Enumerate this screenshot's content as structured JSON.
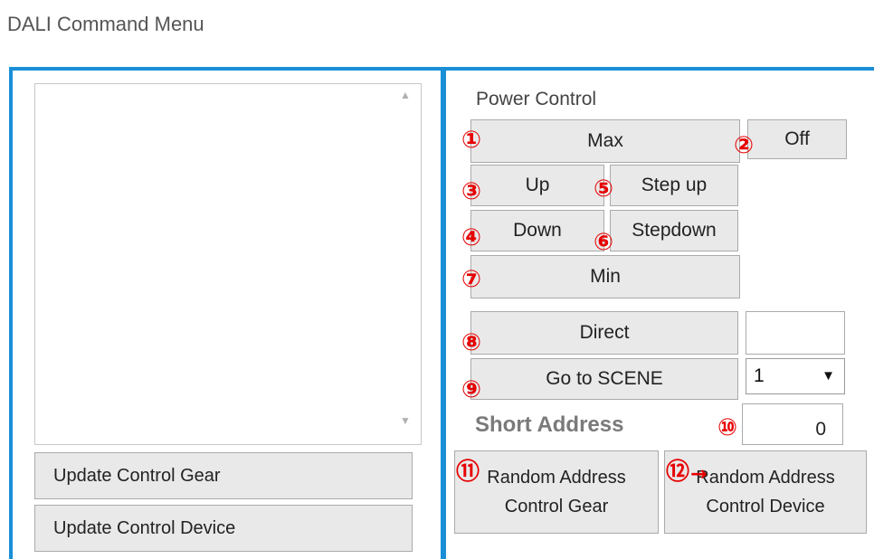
{
  "window": {
    "title": "DALI Command Menu"
  },
  "left_panel": {
    "buttons": {
      "update_gear": "Update  Control Gear",
      "update_device": "Update  Control Device"
    }
  },
  "power_control": {
    "title": "Power Control",
    "max": "Max",
    "off": "Off",
    "up": "Up",
    "step_up": "Step up",
    "down": "Down",
    "step_down": "Stepdown",
    "min": "Min",
    "direct": "Direct",
    "direct_value": "",
    "go_to_scene": "Go to SCENE",
    "scene_selected": "1"
  },
  "short_address": {
    "label": "Short Address",
    "value": "0"
  },
  "random_address": {
    "gear_line1": "Random Address",
    "gear_line2": "Control Gear",
    "device_line1": "Random Address",
    "device_line2": "Control Device"
  },
  "annotations": {
    "n1": "①",
    "n2": "②",
    "n3": "③",
    "n4": "④",
    "n5": "⑤",
    "n6": "⑥",
    "n7": "⑦",
    "n8": "⑧",
    "n9": "⑨",
    "n10": "⑩",
    "n11": "⑪",
    "n12": "⑫",
    "color": "#e60000"
  },
  "colors": {
    "frame_accent": "#1a8fd8",
    "button_bg": "#e9e9e9"
  }
}
